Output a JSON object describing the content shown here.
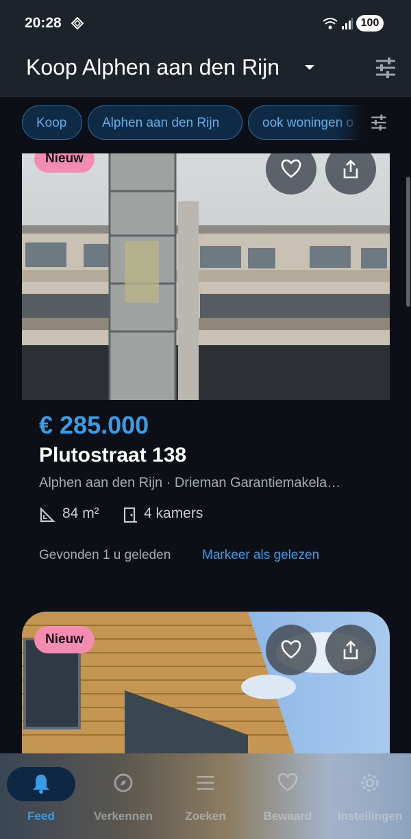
{
  "status_bar": {
    "time": "20:28",
    "battery": "100"
  },
  "app_bar": {
    "title": "Koop Alphen aan den Rijn",
    "dropdown_icon": "caret-down-icon",
    "filter_icon": "tune-icon"
  },
  "chips": [
    {
      "label": "Koop"
    },
    {
      "label": "Alphen aan den Rijn"
    },
    {
      "label": "ook woningen o"
    }
  ],
  "listing1": {
    "badge": "Nieuw",
    "price": "€ 285.000",
    "street": "Plutostraat 138",
    "subtitle": "Alphen aan den Rijn · Drieman Garantiemakela…",
    "area": "84 m²",
    "rooms": "4 kamers",
    "found": "Gevonden 1 u geleden",
    "mark_read": "Markeer als gelezen"
  },
  "listing2": {
    "badge": "Nieuw"
  },
  "nav": [
    {
      "label": "Feed",
      "icon": "bell-icon",
      "active": true
    },
    {
      "label": "Verkennen",
      "icon": "compass-icon"
    },
    {
      "label": "Zoeken",
      "icon": "tune-icon"
    },
    {
      "label": "Bewaard",
      "icon": "heart-icon"
    },
    {
      "label": "Instellingen",
      "icon": "gear-icon"
    }
  ],
  "colors": {
    "accent": "#3a9ce6",
    "badge": "#f48bb0",
    "background": "#0c1016",
    "appbar": "#1c232b"
  }
}
